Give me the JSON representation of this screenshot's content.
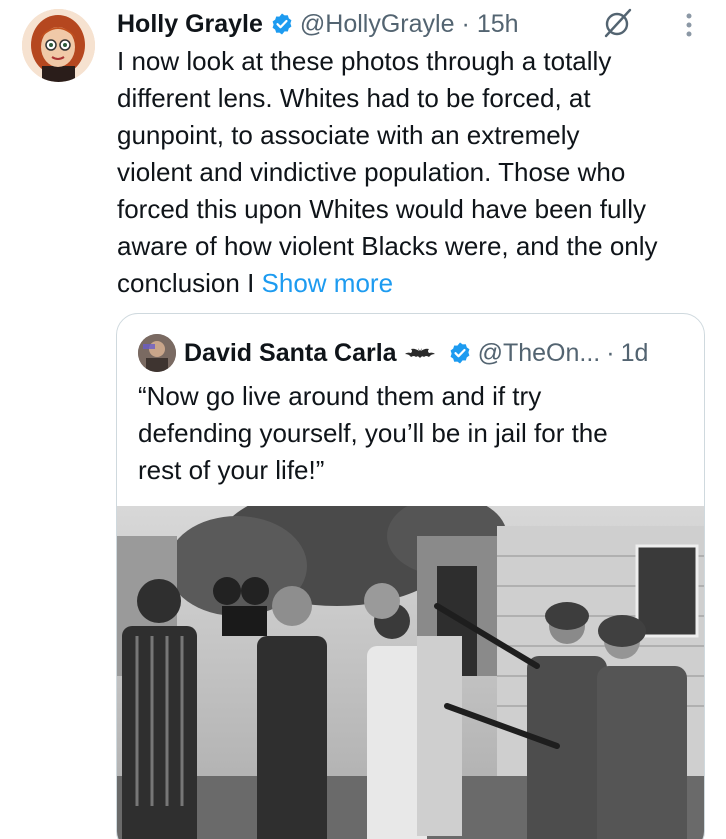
{
  "post": {
    "display_name": "Holly Grayle",
    "handle": "@HollyGrayle",
    "separator": "·",
    "time": "15h",
    "text_lines": [
      "I now look at these photos through a totally",
      "different lens. Whites had to be forced, at",
      "gunpoint, to associate with an extremely",
      "violent and vindictive population. Those who",
      "forced this upon Whites would have been fully",
      "aware of how violent Blacks were, and the only",
      "conclusion I"
    ],
    "show_more": "Show more",
    "icons": {
      "verified": "verified-badge-icon",
      "mute": "mute-icon",
      "more": "more-options-icon"
    },
    "colors": {
      "link": "#1d9bf0",
      "verified": "#1d9bf0",
      "secondary_text": "#536471"
    }
  },
  "quote": {
    "display_name": "David Santa Carla",
    "handle": "@TheOn...",
    "separator": "·",
    "time": "1d",
    "text_lines": [
      "“Now go live around them and if try",
      "defending yourself, you’ll be in jail for the",
      "rest of your life!”"
    ],
    "icons": {
      "emoji": "bat-icon",
      "verified": "verified-badge-icon"
    },
    "media": "black-and-white-photo"
  }
}
